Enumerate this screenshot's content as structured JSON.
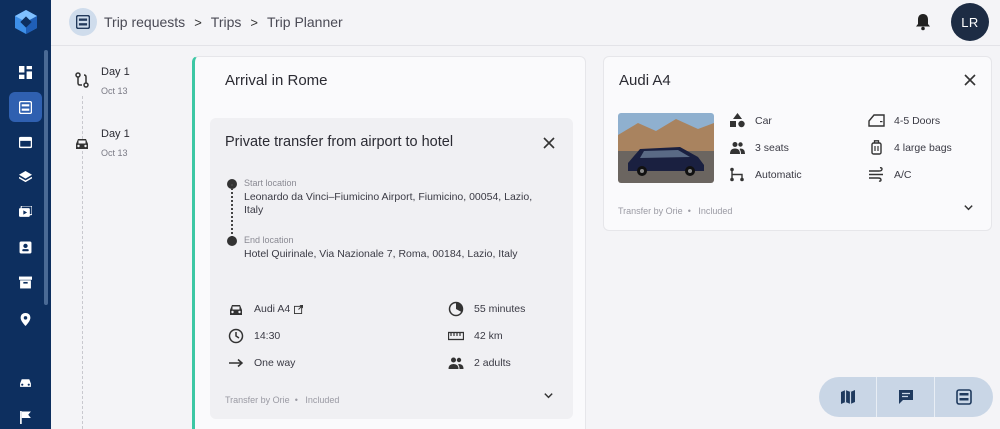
{
  "breadcrumb": {
    "items": [
      "Trip requests",
      "Trips",
      "Trip Planner"
    ],
    "separator": ">"
  },
  "user": {
    "initials": "LR"
  },
  "timeline": [
    {
      "day": "Day 1",
      "date": "Oct 13",
      "icon": "route-icon"
    },
    {
      "day": "Day 1",
      "date": "Oct 13",
      "icon": "car-icon"
    }
  ],
  "arrival": {
    "title": "Arrival in Rome",
    "transfer": {
      "title": "Private transfer from airport to hotel",
      "start_label": "Start location",
      "start_value": "Leonardo da Vinci–Fiumicino Airport, Fiumicino, 00054, Lazio, Italy",
      "end_label": "End location",
      "end_value": "Hotel Quirinale, Via Nazionale 7, Roma, 00184, Lazio, Italy",
      "vehicle": "Audi A4",
      "time": "14:30",
      "direction": "One way",
      "duration": "55 minutes",
      "distance": "42 km",
      "passengers": "2 adults",
      "provider": "Transfer by Orie",
      "included": "Included"
    }
  },
  "car": {
    "title": "Audi A4",
    "features": {
      "type": "Car",
      "seats": "3 seats",
      "transmission": "Automatic",
      "doors": "4-5 Doors",
      "bags": "4 large bags",
      "ac": "A/C"
    },
    "provider": "Transfer by Orie",
    "included": "Included"
  },
  "colors": {
    "rail": "#0d2f5f",
    "rail_active": "#2f60b0",
    "accent": "#3cc7a4",
    "avatar": "#1d2c44"
  },
  "fab_icons": [
    "map-icon",
    "chat-icon",
    "planner-icon"
  ]
}
